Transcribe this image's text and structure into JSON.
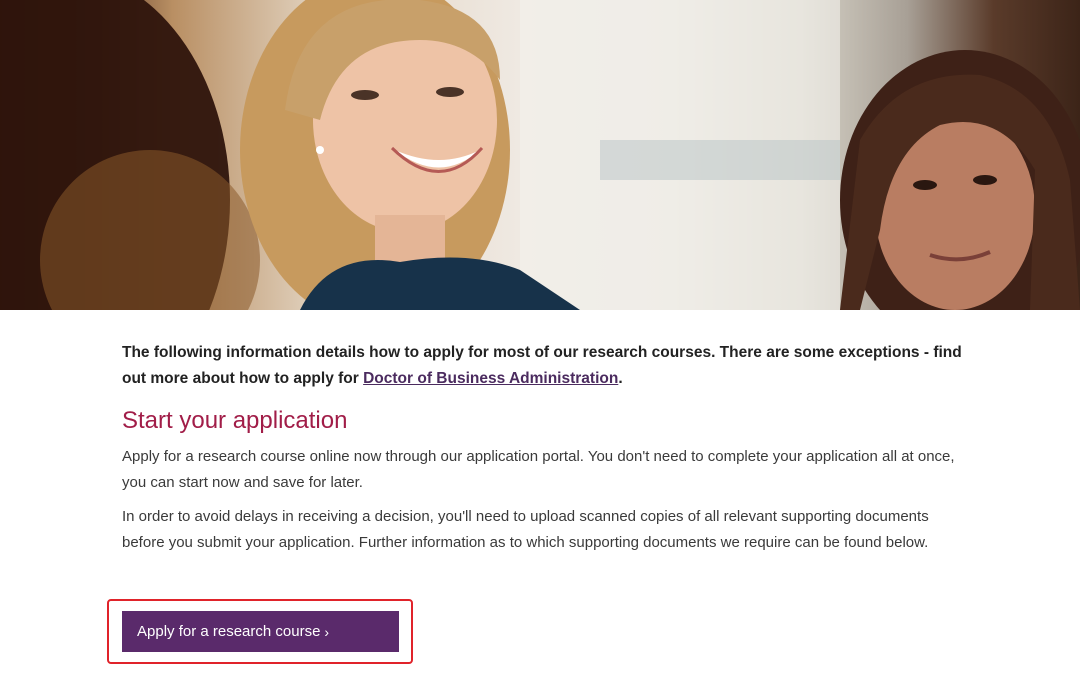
{
  "hero": {
    "image_alt": "Smiling student in a group discussion"
  },
  "intro": {
    "text_before": "The following information details how to apply for most of our research courses. There are some exceptions - find out more about how to apply for ",
    "link_text": "Doctor of Business Administration",
    "text_after": "."
  },
  "section": {
    "heading": "Start your application",
    "paragraph1": "Apply for a research course online now through our application portal. You don't need to complete your application all at once, you can start now and save for later.",
    "paragraph2": "In order to avoid delays in receiving a decision, you'll need to upload scanned copies of all relevant supporting documents before you submit your application. Further information as to which supporting documents we require can be found below."
  },
  "cta": {
    "label": "Apply for a research course",
    "chevron": "›"
  },
  "colors": {
    "heading": "#a11d48",
    "button_bg": "#5a2a6b",
    "link": "#4b2b5f",
    "highlight_border": "#e0232a"
  },
  "icons": {
    "button_arrow": "chevron-right-icon"
  }
}
